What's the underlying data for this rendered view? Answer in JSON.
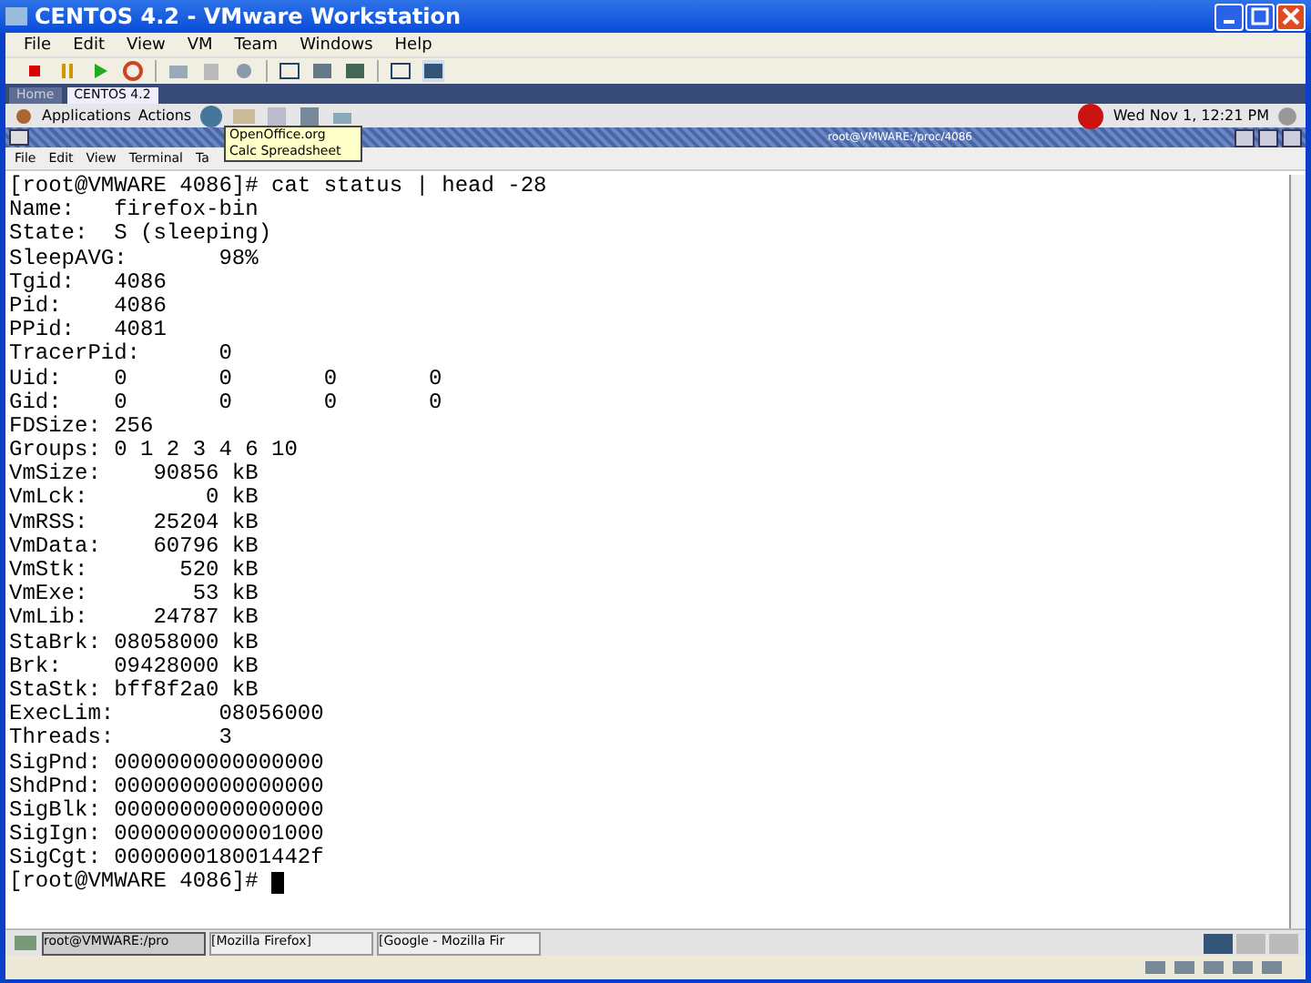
{
  "window": {
    "title": "CENTOS 4.2 - VMware Workstation"
  },
  "menu": [
    "File",
    "Edit",
    "View",
    "VM",
    "Team",
    "Windows",
    "Help"
  ],
  "vm_tabs": [
    {
      "label": "Home",
      "selected": false
    },
    {
      "label": "CENTOS 4.2",
      "selected": true
    }
  ],
  "panel": {
    "menus": [
      "Applications",
      "Actions"
    ],
    "clock": "Wed Nov  1, 12:21 PM"
  },
  "tooltip": "OpenOffice.org Calc Spreadsheet",
  "terminal": {
    "title": "root@VMWARE:/proc/4086",
    "menu": [
      "File",
      "Edit",
      "View",
      "Terminal",
      "Ta"
    ],
    "lines": [
      "[root@VMWARE 4086]# cat status | head -28",
      "Name:   firefox-bin",
      "State:  S (sleeping)",
      "SleepAVG:       98%",
      "Tgid:   4086",
      "Pid:    4086",
      "PPid:   4081",
      "TracerPid:      0",
      "Uid:    0       0       0       0",
      "Gid:    0       0       0       0",
      "FDSize: 256",
      "Groups: 0 1 2 3 4 6 10",
      "VmSize:    90856 kB",
      "VmLck:         0 kB",
      "VmRSS:     25204 kB",
      "VmData:    60796 kB",
      "VmStk:       520 kB",
      "VmExe:        53 kB",
      "VmLib:     24787 kB",
      "StaBrk: 08058000 kB",
      "Brk:    09428000 kB",
      "StaStk: bff8f2a0 kB",
      "ExecLim:        08056000",
      "Threads:        3",
      "SigPnd: 0000000000000000",
      "ShdPnd: 0000000000000000",
      "SigBlk: 0000000000000000",
      "SigIgn: 0000000000001000",
      "SigCgt: 000000018001442f",
      "[root@VMWARE 4086]# "
    ]
  },
  "taskbar": [
    {
      "label": "root@VMWARE:/pro",
      "selected": true
    },
    {
      "label": "[Mozilla Firefox]",
      "selected": false
    },
    {
      "label": "[Google - Mozilla Fir",
      "selected": false
    }
  ]
}
